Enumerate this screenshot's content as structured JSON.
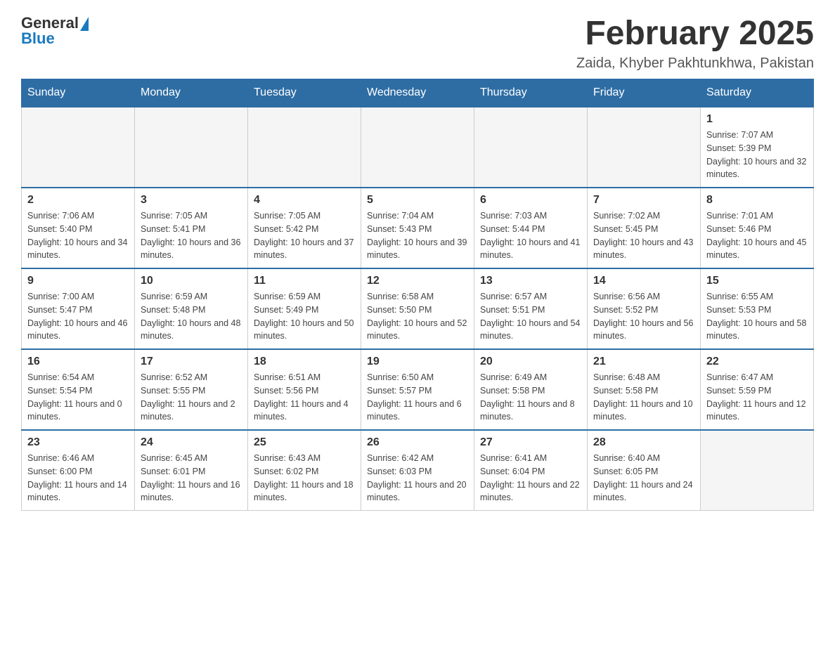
{
  "logo": {
    "general": "General",
    "blue": "Blue"
  },
  "title": "February 2025",
  "subtitle": "Zaida, Khyber Pakhtunkhwa, Pakistan",
  "weekdays": [
    "Sunday",
    "Monday",
    "Tuesday",
    "Wednesday",
    "Thursday",
    "Friday",
    "Saturday"
  ],
  "weeks": [
    [
      {
        "day": "",
        "info": ""
      },
      {
        "day": "",
        "info": ""
      },
      {
        "day": "",
        "info": ""
      },
      {
        "day": "",
        "info": ""
      },
      {
        "day": "",
        "info": ""
      },
      {
        "day": "",
        "info": ""
      },
      {
        "day": "1",
        "info": "Sunrise: 7:07 AM\nSunset: 5:39 PM\nDaylight: 10 hours and 32 minutes."
      }
    ],
    [
      {
        "day": "2",
        "info": "Sunrise: 7:06 AM\nSunset: 5:40 PM\nDaylight: 10 hours and 34 minutes."
      },
      {
        "day": "3",
        "info": "Sunrise: 7:05 AM\nSunset: 5:41 PM\nDaylight: 10 hours and 36 minutes."
      },
      {
        "day": "4",
        "info": "Sunrise: 7:05 AM\nSunset: 5:42 PM\nDaylight: 10 hours and 37 minutes."
      },
      {
        "day": "5",
        "info": "Sunrise: 7:04 AM\nSunset: 5:43 PM\nDaylight: 10 hours and 39 minutes."
      },
      {
        "day": "6",
        "info": "Sunrise: 7:03 AM\nSunset: 5:44 PM\nDaylight: 10 hours and 41 minutes."
      },
      {
        "day": "7",
        "info": "Sunrise: 7:02 AM\nSunset: 5:45 PM\nDaylight: 10 hours and 43 minutes."
      },
      {
        "day": "8",
        "info": "Sunrise: 7:01 AM\nSunset: 5:46 PM\nDaylight: 10 hours and 45 minutes."
      }
    ],
    [
      {
        "day": "9",
        "info": "Sunrise: 7:00 AM\nSunset: 5:47 PM\nDaylight: 10 hours and 46 minutes."
      },
      {
        "day": "10",
        "info": "Sunrise: 6:59 AM\nSunset: 5:48 PM\nDaylight: 10 hours and 48 minutes."
      },
      {
        "day": "11",
        "info": "Sunrise: 6:59 AM\nSunset: 5:49 PM\nDaylight: 10 hours and 50 minutes."
      },
      {
        "day": "12",
        "info": "Sunrise: 6:58 AM\nSunset: 5:50 PM\nDaylight: 10 hours and 52 minutes."
      },
      {
        "day": "13",
        "info": "Sunrise: 6:57 AM\nSunset: 5:51 PM\nDaylight: 10 hours and 54 minutes."
      },
      {
        "day": "14",
        "info": "Sunrise: 6:56 AM\nSunset: 5:52 PM\nDaylight: 10 hours and 56 minutes."
      },
      {
        "day": "15",
        "info": "Sunrise: 6:55 AM\nSunset: 5:53 PM\nDaylight: 10 hours and 58 minutes."
      }
    ],
    [
      {
        "day": "16",
        "info": "Sunrise: 6:54 AM\nSunset: 5:54 PM\nDaylight: 11 hours and 0 minutes."
      },
      {
        "day": "17",
        "info": "Sunrise: 6:52 AM\nSunset: 5:55 PM\nDaylight: 11 hours and 2 minutes."
      },
      {
        "day": "18",
        "info": "Sunrise: 6:51 AM\nSunset: 5:56 PM\nDaylight: 11 hours and 4 minutes."
      },
      {
        "day": "19",
        "info": "Sunrise: 6:50 AM\nSunset: 5:57 PM\nDaylight: 11 hours and 6 minutes."
      },
      {
        "day": "20",
        "info": "Sunrise: 6:49 AM\nSunset: 5:58 PM\nDaylight: 11 hours and 8 minutes."
      },
      {
        "day": "21",
        "info": "Sunrise: 6:48 AM\nSunset: 5:58 PM\nDaylight: 11 hours and 10 minutes."
      },
      {
        "day": "22",
        "info": "Sunrise: 6:47 AM\nSunset: 5:59 PM\nDaylight: 11 hours and 12 minutes."
      }
    ],
    [
      {
        "day": "23",
        "info": "Sunrise: 6:46 AM\nSunset: 6:00 PM\nDaylight: 11 hours and 14 minutes."
      },
      {
        "day": "24",
        "info": "Sunrise: 6:45 AM\nSunset: 6:01 PM\nDaylight: 11 hours and 16 minutes."
      },
      {
        "day": "25",
        "info": "Sunrise: 6:43 AM\nSunset: 6:02 PM\nDaylight: 11 hours and 18 minutes."
      },
      {
        "day": "26",
        "info": "Sunrise: 6:42 AM\nSunset: 6:03 PM\nDaylight: 11 hours and 20 minutes."
      },
      {
        "day": "27",
        "info": "Sunrise: 6:41 AM\nSunset: 6:04 PM\nDaylight: 11 hours and 22 minutes."
      },
      {
        "day": "28",
        "info": "Sunrise: 6:40 AM\nSunset: 6:05 PM\nDaylight: 11 hours and 24 minutes."
      },
      {
        "day": "",
        "info": ""
      }
    ]
  ]
}
